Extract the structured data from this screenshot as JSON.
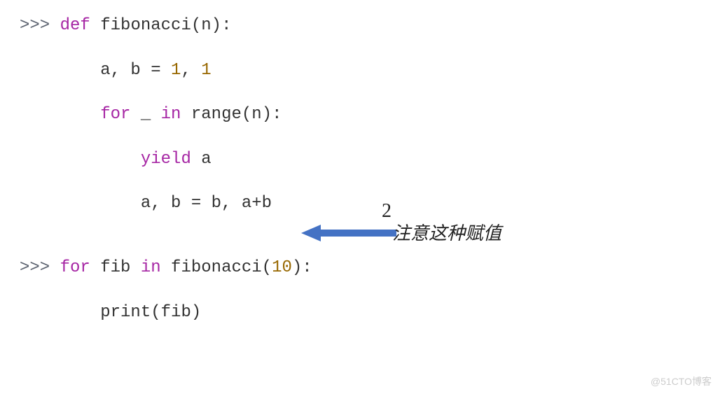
{
  "code": {
    "prompt": ">>> ",
    "indent1": "        ",
    "indent2": "            ",
    "l1": {
      "t1": ">>> ",
      "t2": "def",
      "t3": " ",
      "t4": "fibonacci",
      "t5": "(n):"
    },
    "l2": {
      "t1": "        a, b ",
      "t2": "=",
      "t3": " ",
      "t4": "1",
      "t5": ", ",
      "t6": "1"
    },
    "l3": {
      "t1": "        ",
      "t2": "for",
      "t3": " _ ",
      "t4": "in",
      "t5": " ",
      "t6": "range",
      "t7": "(n):"
    },
    "l4": {
      "t1": "            ",
      "t2": "yield",
      "t3": " a"
    },
    "l5": {
      "t1": "            a, b ",
      "t2": "=",
      "t3": " b, a",
      "t4": "+",
      "t5": "b"
    },
    "l6": {
      "t1": ">>> ",
      "t2": "for",
      "t3": " fib ",
      "t4": "in",
      "t5": " fibonacci(",
      "t6": "10",
      "t7": "):"
    },
    "l7": {
      "t1": "        ",
      "t2": "print",
      "t3": "(fib)"
    }
  },
  "annotation": {
    "number": "2",
    "text": "注意这种赋值"
  },
  "watermark": "@51CTO博客"
}
